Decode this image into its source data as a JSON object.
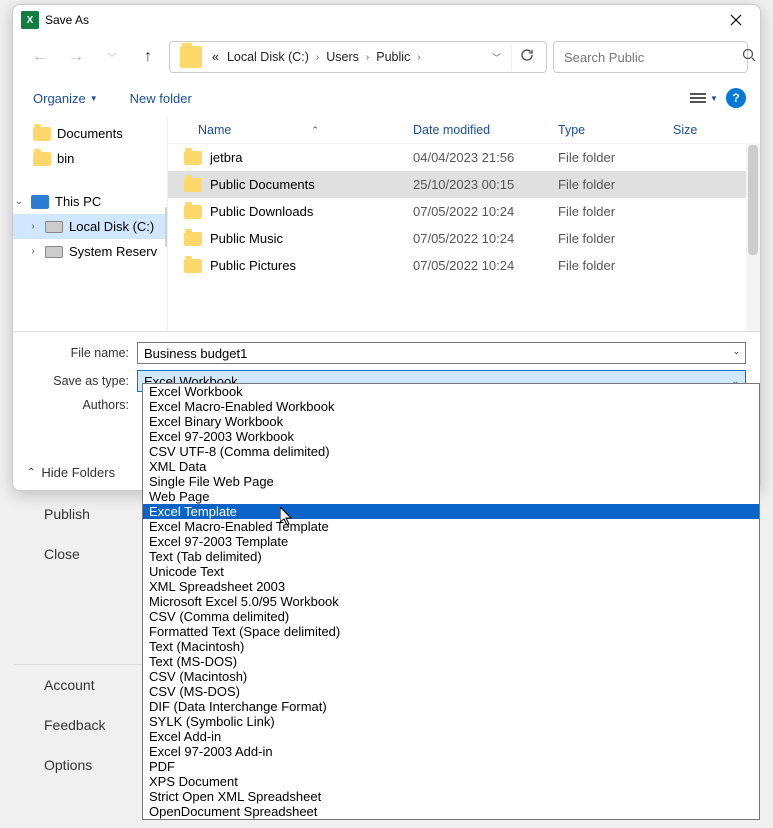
{
  "window": {
    "title": "Save As"
  },
  "nav": {
    "breadcrumb_prefix": "«",
    "crumbs": [
      "Local Disk (C:)",
      "Users",
      "Public"
    ]
  },
  "search": {
    "placeholder": "Search Public"
  },
  "toolbar": {
    "organize": "Organize",
    "new_folder": "New folder"
  },
  "columns": {
    "name": "Name",
    "date": "Date modified",
    "type": "Type",
    "size": "Size"
  },
  "tree": {
    "documents": "Documents",
    "bin": "bin",
    "this_pc": "This PC",
    "local_disk": "Local Disk (C:)",
    "sys_res": "System Reserv"
  },
  "rows": [
    {
      "name": "jetbra",
      "date": "04/04/2023 21:56",
      "type": "File folder",
      "selected": false
    },
    {
      "name": "Public Documents",
      "date": "25/10/2023 00:15",
      "type": "File folder",
      "selected": true
    },
    {
      "name": "Public Downloads",
      "date": "07/05/2022 10:24",
      "type": "File folder",
      "selected": false
    },
    {
      "name": "Public Music",
      "date": "07/05/2022 10:24",
      "type": "File folder",
      "selected": false
    },
    {
      "name": "Public Pictures",
      "date": "07/05/2022 10:24",
      "type": "File folder",
      "selected": false
    }
  ],
  "fields": {
    "file_name_label": "File name:",
    "file_name_value": "Business budget1",
    "type_label": "Save as type:",
    "type_value": "Excel Workbook",
    "authors_label": "Authors:"
  },
  "hide_folders": "Hide Folders",
  "type_options": [
    "Excel Workbook",
    "Excel Macro-Enabled Workbook",
    "Excel Binary Workbook",
    "Excel 97-2003 Workbook",
    "CSV UTF-8 (Comma delimited)",
    "XML Data",
    "Single File Web Page",
    "Web Page",
    "Excel Template",
    "Excel Macro-Enabled Template",
    "Excel 97-2003 Template",
    "Text (Tab delimited)",
    "Unicode Text",
    "XML Spreadsheet 2003",
    "Microsoft Excel 5.0/95 Workbook",
    "CSV (Comma delimited)",
    "Formatted Text (Space delimited)",
    "Text (Macintosh)",
    "Text (MS-DOS)",
    "CSV (Macintosh)",
    "CSV (MS-DOS)",
    "DIF (Data Interchange Format)",
    "SYLK (Symbolic Link)",
    "Excel Add-in",
    "Excel 97-2003 Add-in",
    "PDF",
    "XPS Document",
    "Strict Open XML Spreadsheet",
    "OpenDocument Spreadsheet"
  ],
  "type_highlight_index": 8,
  "backstage": {
    "publish": "Publish",
    "close": "Close",
    "account": "Account",
    "feedback": "Feedback",
    "options": "Options"
  }
}
